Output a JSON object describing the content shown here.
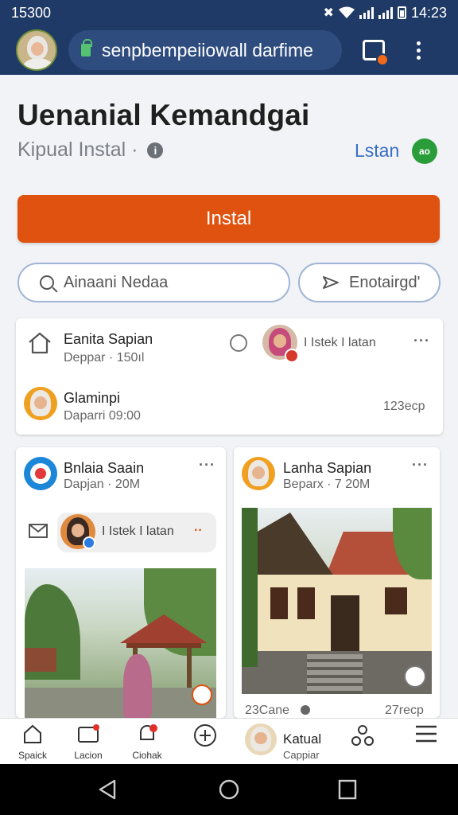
{
  "status_bar": {
    "left_text": "15300",
    "time": "14:23"
  },
  "browser": {
    "url": "senpbempeiiowall darfime"
  },
  "page": {
    "title": "Uenanial Kemandgai",
    "subtitle": "Kipual Instal ·",
    "listen_link": "Lstan",
    "listen_badge": "ао",
    "install_label": "Instal",
    "search_placeholder": "Ainaani Nedaa",
    "explore_label": "Enotairgd'"
  },
  "top_card": {
    "row1_name": "Eanita Sapian",
    "row1_meta": "Deppar · 150ıl",
    "row1_side_label": "I Istek I latan",
    "row2_name": "Glaminpi",
    "row2_meta": "Daparri 09:00",
    "row2_side": "123ecp"
  },
  "left_card": {
    "name": "Bnlaia Saain",
    "meta": "Dapjan · 20M",
    "comment": "I Istek I latan"
  },
  "right_card": {
    "name": "Lanha Sapian",
    "meta": "Beparx · 7 20M",
    "footer_left": "23Cane",
    "footer_right": "27recp"
  },
  "bottom_nav": {
    "items": [
      {
        "label": "Spaick"
      },
      {
        "label": "Lacion"
      },
      {
        "label": "Ciohak"
      },
      {
        "label": ""
      },
      {
        "label": "Katual"
      },
      {
        "label": "Cappiar"
      }
    ]
  },
  "colors": {
    "header": "#1f3a66",
    "install": "#e0520f",
    "link": "#3a6fc4",
    "badge": "#2a9d3a"
  }
}
